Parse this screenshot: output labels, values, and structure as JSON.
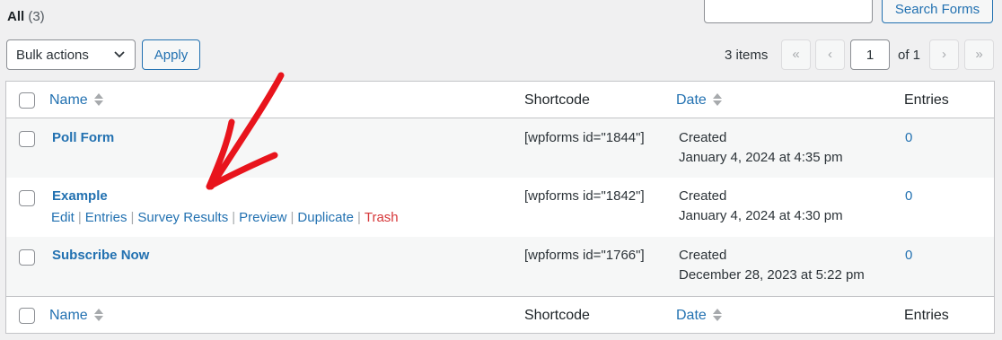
{
  "filter": {
    "all_label": "All",
    "all_count": "(3)"
  },
  "search": {
    "button_label": "Search Forms",
    "value": ""
  },
  "bulk": {
    "selected": "Bulk actions",
    "apply_label": "Apply"
  },
  "pagination": {
    "items": "3 items",
    "first": "«",
    "prev": "‹",
    "current_page": "1",
    "of": "of 1",
    "next": "›",
    "last": "»"
  },
  "columns": {
    "name": "Name",
    "shortcode": "Shortcode",
    "date": "Date",
    "entries": "Entries"
  },
  "rows": [
    {
      "title": "Poll Form",
      "shortcode": "[wpforms id=\"1844\"]",
      "status": "Created",
      "date": "January 4, 2024 at 4:35 pm",
      "entries": "0"
    },
    {
      "title": "Example",
      "shortcode": "[wpforms id=\"1842\"]",
      "status": "Created",
      "date": "January 4, 2024 at 4:30 pm",
      "entries": "0",
      "actions": {
        "edit": "Edit",
        "entries": "Entries",
        "survey": "Survey Results",
        "preview": "Preview",
        "duplicate": "Duplicate",
        "trash": "Trash"
      }
    },
    {
      "title": "Subscribe Now",
      "shortcode": "[wpforms id=\"1766\"]",
      "status": "Created",
      "date": "December 28, 2023 at 5:22 pm",
      "entries": "0"
    }
  ],
  "colors": {
    "link": "#2271b1",
    "trash": "#d63638",
    "annotation_arrow": "#e8141c"
  },
  "icons": {
    "sort": "sort-arrows-icon",
    "chevron": "chevron-down-icon"
  }
}
